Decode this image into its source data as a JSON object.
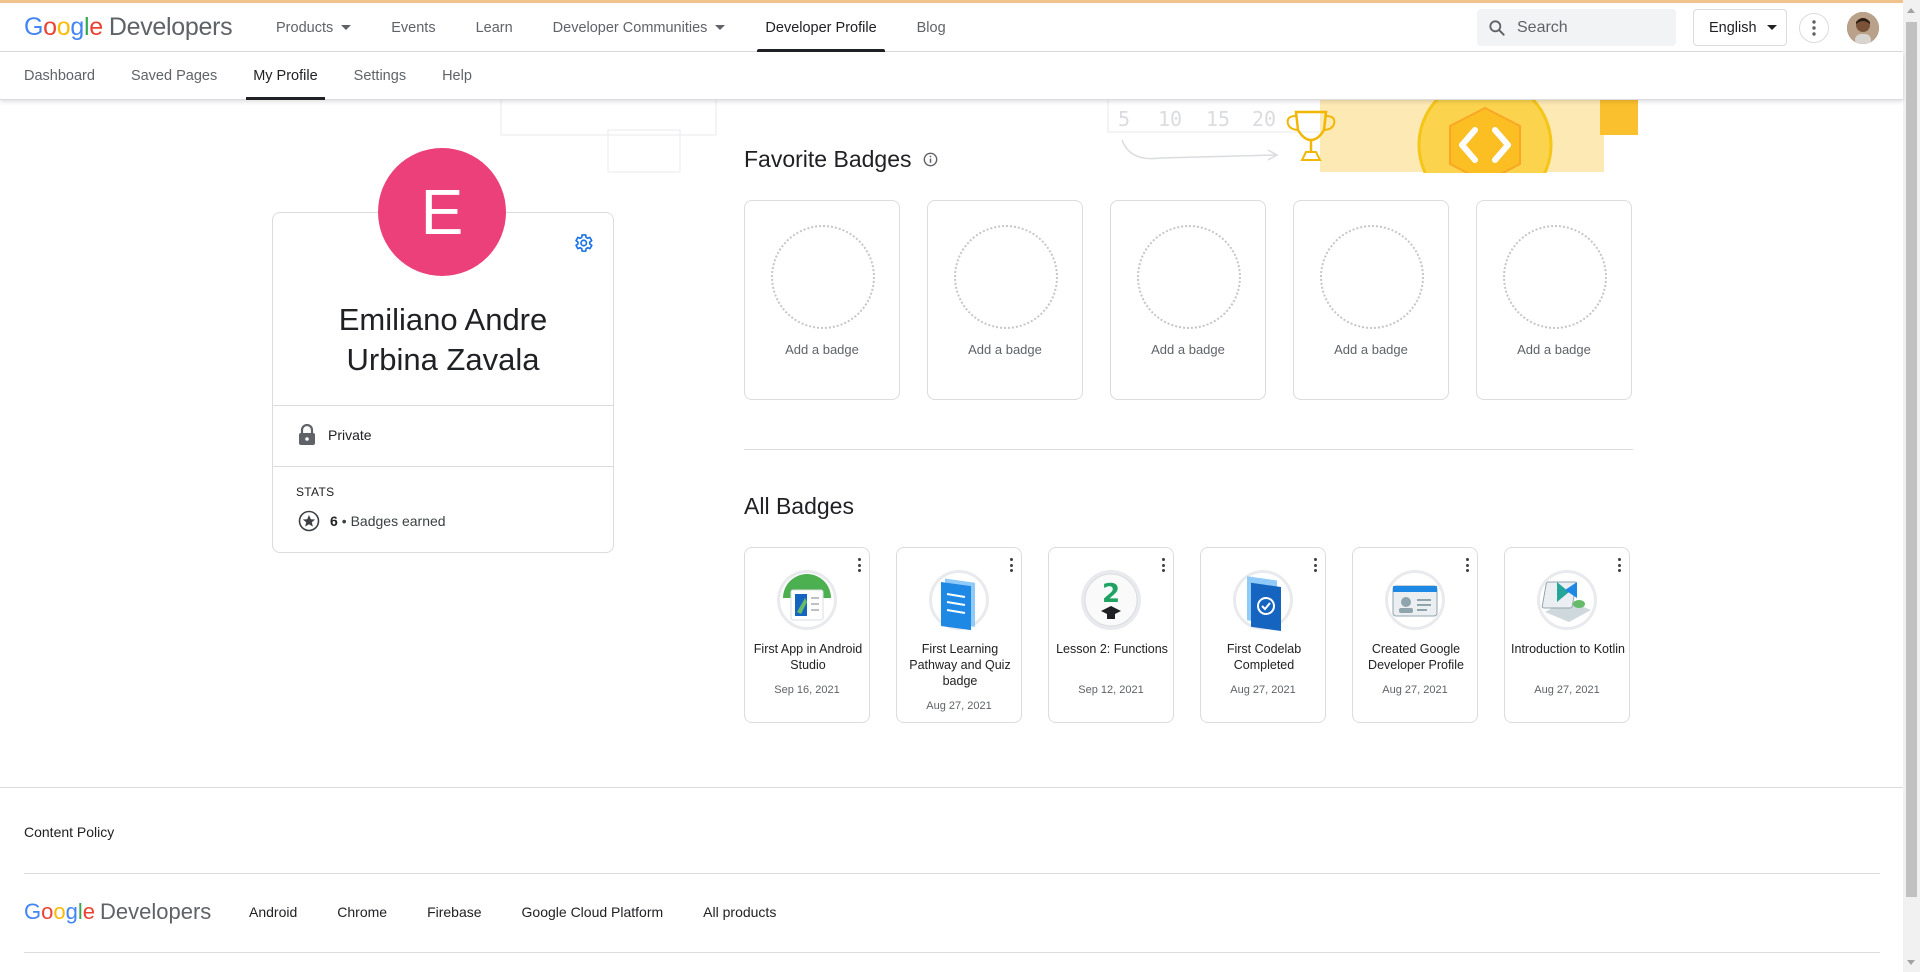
{
  "brand": {
    "google": "Google",
    "developers": "Developers"
  },
  "top_nav": {
    "items": [
      {
        "label": "Products",
        "dropdown": true
      },
      {
        "label": "Events"
      },
      {
        "label": "Learn"
      },
      {
        "label": "Developer Communities",
        "dropdown": true
      },
      {
        "label": "Developer Profile",
        "active": true
      },
      {
        "label": "Blog"
      }
    ],
    "search_placeholder": "Search",
    "language": "English"
  },
  "sub_nav": {
    "items": [
      {
        "label": "Dashboard"
      },
      {
        "label": "Saved Pages"
      },
      {
        "label": "My Profile",
        "active": true
      },
      {
        "label": "Settings"
      },
      {
        "label": "Help"
      }
    ]
  },
  "profile": {
    "initial": "E",
    "avatar_color": "#ec407a",
    "name_line1": "Emiliano Andre",
    "name_line2": "Urbina Zavala",
    "privacy": "Private",
    "stats_title": "STATS",
    "badges_count": "6",
    "badges_label": "• Badges earned"
  },
  "banner": {
    "numbers": [
      "5",
      "10",
      "15",
      "20"
    ]
  },
  "favorite_badges": {
    "heading": "Favorite Badges",
    "slots": [
      {
        "label": "Add a badge"
      },
      {
        "label": "Add a badge"
      },
      {
        "label": "Add a badge"
      },
      {
        "label": "Add a badge"
      },
      {
        "label": "Add a badge"
      }
    ]
  },
  "all_badges": {
    "heading": "All Badges",
    "items": [
      {
        "title": "First App in Android Studio",
        "date": "Sep 16, 2021",
        "icon": "android-studio-badge-icon"
      },
      {
        "title": "First Learning Pathway and Quiz badge",
        "date": "Aug 27, 2021",
        "icon": "learning-pathway-badge-icon"
      },
      {
        "title": "Lesson 2: Functions",
        "date": "Sep 12, 2021",
        "icon": "lesson-2-badge-icon"
      },
      {
        "title": "First Codelab Completed",
        "date": "Aug 27, 2021",
        "icon": "codelab-badge-icon"
      },
      {
        "title": "Created Google Developer Profile",
        "date": "Aug 27, 2021",
        "icon": "profile-badge-icon"
      },
      {
        "title": "Introduction to Kotlin",
        "date": "Aug 27, 2021",
        "icon": "kotlin-badge-icon"
      }
    ]
  },
  "footer": {
    "content_policy": "Content Policy",
    "links": [
      "Android",
      "Chrome",
      "Firebase",
      "Google Cloud Platform",
      "All products"
    ]
  }
}
